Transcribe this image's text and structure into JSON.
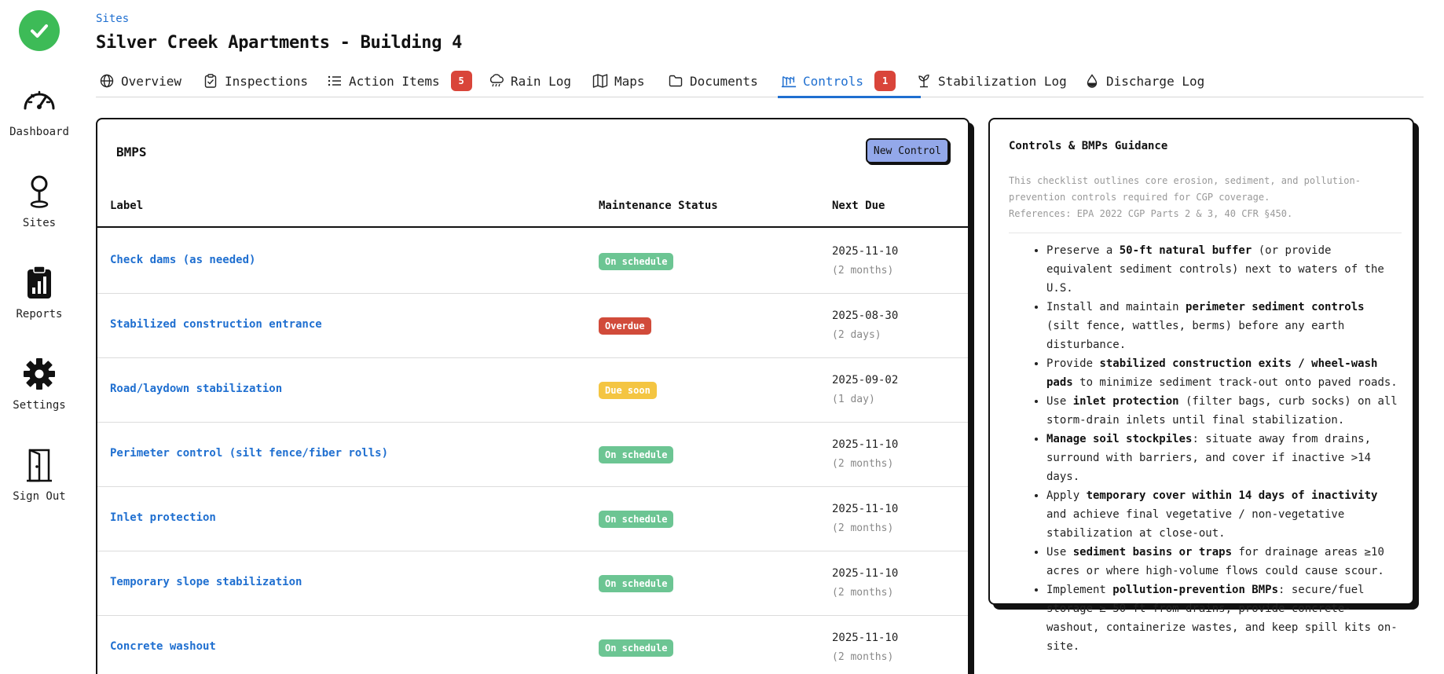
{
  "sidebar": {
    "items": [
      {
        "label": "Dashboard",
        "icon": "dashboard-gauge-icon"
      },
      {
        "label": "Sites",
        "icon": "map-pin-icon"
      },
      {
        "label": "Reports",
        "icon": "clipboard-chart-icon"
      },
      {
        "label": "Settings",
        "icon": "gear-icon"
      },
      {
        "label": "Sign Out",
        "icon": "door-icon"
      }
    ],
    "logo_color": "#3dbb57"
  },
  "header": {
    "breadcrumb": "Sites",
    "title": "Silver Creek Apartments - Building 4"
  },
  "tabs": [
    {
      "label": "Overview",
      "icon": "globe-icon"
    },
    {
      "label": "Inspections",
      "icon": "clipboard-check-icon"
    },
    {
      "label": "Action Items",
      "icon": "list-icon",
      "badge": "5"
    },
    {
      "label": "Rain Log",
      "icon": "rain-cloud-icon"
    },
    {
      "label": "Maps",
      "icon": "map-icon"
    },
    {
      "label": "Documents",
      "icon": "folder-icon"
    },
    {
      "label": "Controls",
      "icon": "fence-icon",
      "badge": "1",
      "active": true
    },
    {
      "label": "Stabilization Log",
      "icon": "sprout-icon"
    },
    {
      "label": "Discharge Log",
      "icon": "droplet-icon"
    }
  ],
  "bmps": {
    "title": "BMPS",
    "new_button": "New Control",
    "columns": [
      "Label",
      "Maintenance Status",
      "Next Due"
    ],
    "rows": [
      {
        "label": "Check dams (as needed)",
        "status": "On schedule",
        "status_kind": "ok",
        "due": "2025-11-10",
        "due_rel": "(2 months)"
      },
      {
        "label": "Stabilized construction entrance",
        "status": "Overdue",
        "status_kind": "overdue",
        "due": "2025-08-30",
        "due_rel": "(2 days)"
      },
      {
        "label": "Road/laydown stabilization",
        "status": "Due soon",
        "status_kind": "soon",
        "due": "2025-09-02",
        "due_rel": "(1 day)"
      },
      {
        "label": "Perimeter control (silt fence/fiber rolls)",
        "status": "On schedule",
        "status_kind": "ok",
        "due": "2025-11-10",
        "due_rel": "(2 months)"
      },
      {
        "label": "Inlet protection",
        "status": "On schedule",
        "status_kind": "ok",
        "due": "2025-11-10",
        "due_rel": "(2 months)"
      },
      {
        "label": "Temporary slope stabilization",
        "status": "On schedule",
        "status_kind": "ok",
        "due": "2025-11-10",
        "due_rel": "(2 months)"
      },
      {
        "label": "Concrete washout",
        "status": "On schedule",
        "status_kind": "ok",
        "due": "2025-11-10",
        "due_rel": "(2 months)"
      }
    ]
  },
  "guidance": {
    "title": "Controls & BMPs Guidance",
    "intro_1": "This checklist outlines core erosion, sediment, and pollution-prevention controls required for CGP coverage.",
    "intro_2": "References: EPA 2022 CGP Parts 2 & 3, 40 CFR §450.",
    "items": [
      {
        "pre": "Preserve a ",
        "bold": "50-ft natural buffer",
        "post": " (or provide equivalent sediment controls) next to waters of the U.S."
      },
      {
        "pre": "Install and maintain ",
        "bold": "perimeter sediment controls",
        "post": " (silt fence, wattles, berms) before any earth disturbance."
      },
      {
        "pre": "Provide ",
        "bold": "stabilized construction exits / wheel-wash pads",
        "post": " to minimize sediment track-out onto paved roads."
      },
      {
        "pre": "Use ",
        "bold": "inlet protection",
        "post": " (filter bags, curb socks) on all storm-drain inlets until final stabilization."
      },
      {
        "pre": "",
        "bold": "Manage soil stockpiles",
        "post": ": situate away from drains, surround with barriers, and cover if inactive >14 days."
      },
      {
        "pre": "Apply ",
        "bold": "temporary cover within 14 days of inactivity",
        "post": " and achieve final vegetative / non-vegetative stabilization at close-out."
      },
      {
        "pre": "Use ",
        "bold": "sediment basins or traps",
        "post": " for drainage areas ≥10 acres or where high-volume flows could cause scour."
      },
      {
        "pre": "Implement ",
        "bold": "pollution-prevention BMPs",
        "post": ": secure/fuel storage ≥ 50 ft from drains, provide concrete-washout, containerize wastes, and keep spill kits on-site."
      }
    ]
  },
  "colors": {
    "accent": "#1f6fd0",
    "badge_red": "#d9453a",
    "on_schedule": "#6cc593",
    "overdue": "#d14b3a",
    "due_soon": "#f4c542",
    "button_fill": "#93a8ea"
  }
}
